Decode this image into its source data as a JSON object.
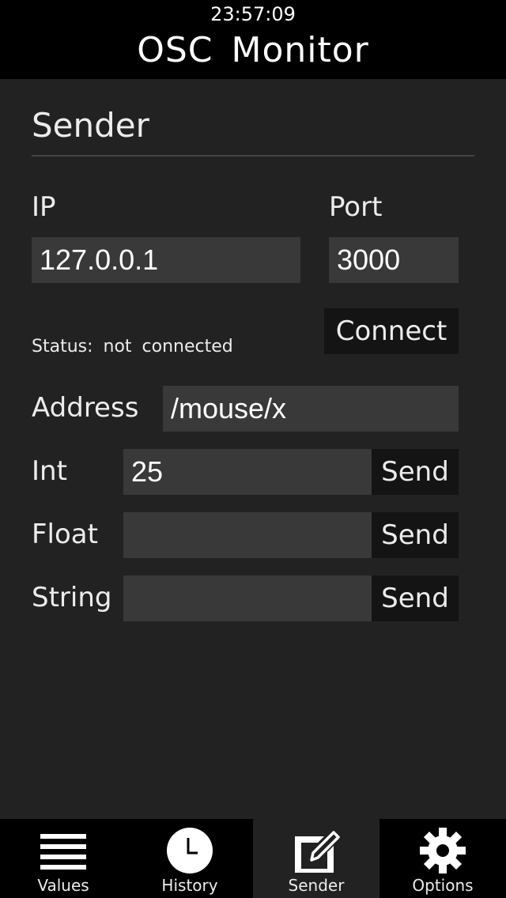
{
  "status_bar": {
    "time": "23:57:09"
  },
  "app": {
    "title": "OSC Monitor"
  },
  "sender": {
    "section_title": "Sender",
    "ip_label": "IP",
    "ip_value": "127.0.0.1",
    "port_label": "Port",
    "port_value": "3000",
    "connect_label": "Connect",
    "status_text": "Status: not connected",
    "address_label": "Address",
    "address_value": "/mouse/x",
    "int_label": "Int",
    "int_value": "25",
    "float_label": "Float",
    "float_value": "",
    "string_label": "String",
    "string_value": "",
    "send_label": "Send"
  },
  "tabs": [
    {
      "label": "Values",
      "icon": "list-icon",
      "active": false
    },
    {
      "label": "History",
      "icon": "clock-icon",
      "active": false
    },
    {
      "label": "Sender",
      "icon": "edit-icon",
      "active": true
    },
    {
      "label": "Options",
      "icon": "gear-icon",
      "active": false
    }
  ],
  "colors": {
    "background": "#222222",
    "bar": "#000000",
    "field": "#393939",
    "button": "#141414",
    "text": "#ececec"
  }
}
